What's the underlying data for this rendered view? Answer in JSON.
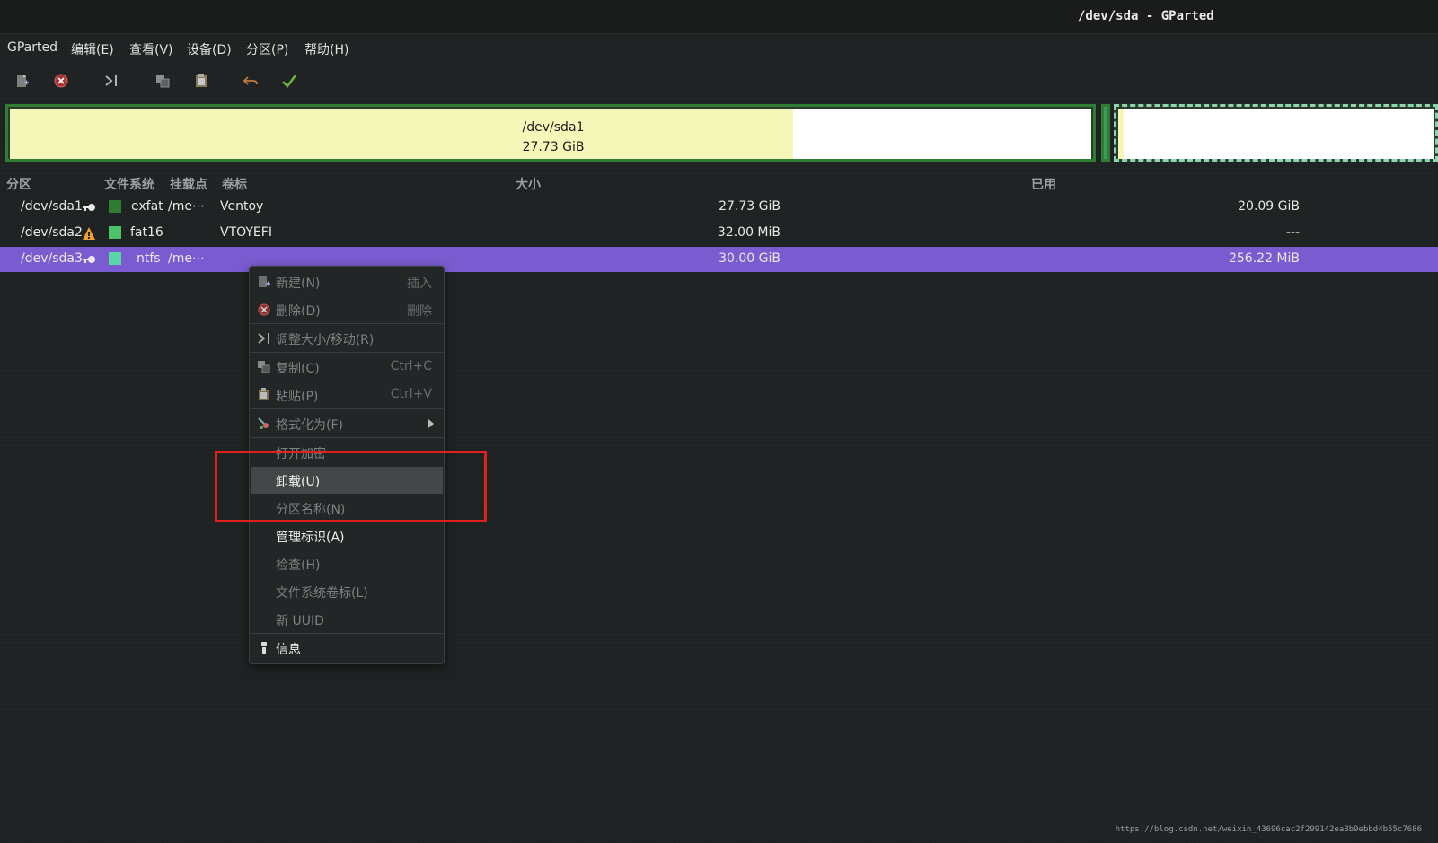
{
  "window": {
    "title": "/dev/sda - GParted"
  },
  "menubar": {
    "items": [
      "GParted",
      "编辑(E)",
      "查看(V)",
      "设备(D)",
      "分区(P)",
      "帮助(H)"
    ]
  },
  "toolbar": {
    "icons": [
      "new-partition-icon",
      "delete-icon",
      "resize-move-icon",
      "copy-icon",
      "paste-icon",
      "undo-icon",
      "apply-icon"
    ]
  },
  "diskmap": {
    "sda1": {
      "name": "/dev/sda1",
      "size": "27.73 GiB",
      "used_fraction": 0.724
    },
    "sda3": {
      "used_fraction": 0.008
    }
  },
  "table": {
    "headers": {
      "partition": "分区",
      "filesystem": "文件系统",
      "mountpoint": "挂载点",
      "label": "卷标",
      "size": "大小",
      "used": "已用"
    },
    "rows": [
      {
        "partition": "/dev/sda1",
        "status_icon": "key-icon",
        "fs_color": "#2e7d32",
        "filesystem": "exfat",
        "mountpoint": "/me⋯",
        "label": "Ventoy",
        "size": "27.73 GiB",
        "used": "20.09 GiB",
        "selected": false
      },
      {
        "partition": "/dev/sda2",
        "status_icon": "warning-icon",
        "fs_color": "#4cc26a",
        "filesystem": "fat16",
        "mountpoint": "",
        "label": "VTOYEFI",
        "size": "32.00 MiB",
        "used": "---",
        "selected": false
      },
      {
        "partition": "/dev/sda3",
        "status_icon": "key-icon",
        "fs_color": "#5ad6a6",
        "filesystem": "ntfs",
        "mountpoint": "/me⋯",
        "label": "",
        "size": "30.00 GiB",
        "used": "256.22 MiB",
        "selected": true
      }
    ]
  },
  "context_menu": {
    "new": {
      "label": "新建(N)",
      "accel": "插入"
    },
    "delete": {
      "label": "删除(D)",
      "accel": "删除"
    },
    "resize": {
      "label": "调整大小/移动(R)"
    },
    "copy": {
      "label": "复制(C)",
      "accel": "Ctrl+C"
    },
    "paste": {
      "label": "粘贴(P)",
      "accel": "Ctrl+V"
    },
    "format": {
      "label": "格式化为(F)"
    },
    "open_encryption": {
      "label": "打开加密"
    },
    "unmount": {
      "label": "卸载(U)"
    },
    "partition_name": {
      "label": "分区名称(N)"
    },
    "manage_flags": {
      "label": "管理标识(A)"
    },
    "check": {
      "label": "检查(H)"
    },
    "fs_label": {
      "label": "文件系统卷标(L)"
    },
    "new_uuid": {
      "label": "新 UUID"
    },
    "info": {
      "label": "信息"
    }
  },
  "watermark": "https://blog.csdn.net/weixin_43696cac2f299142ea8b9ebbd4b55c7686"
}
